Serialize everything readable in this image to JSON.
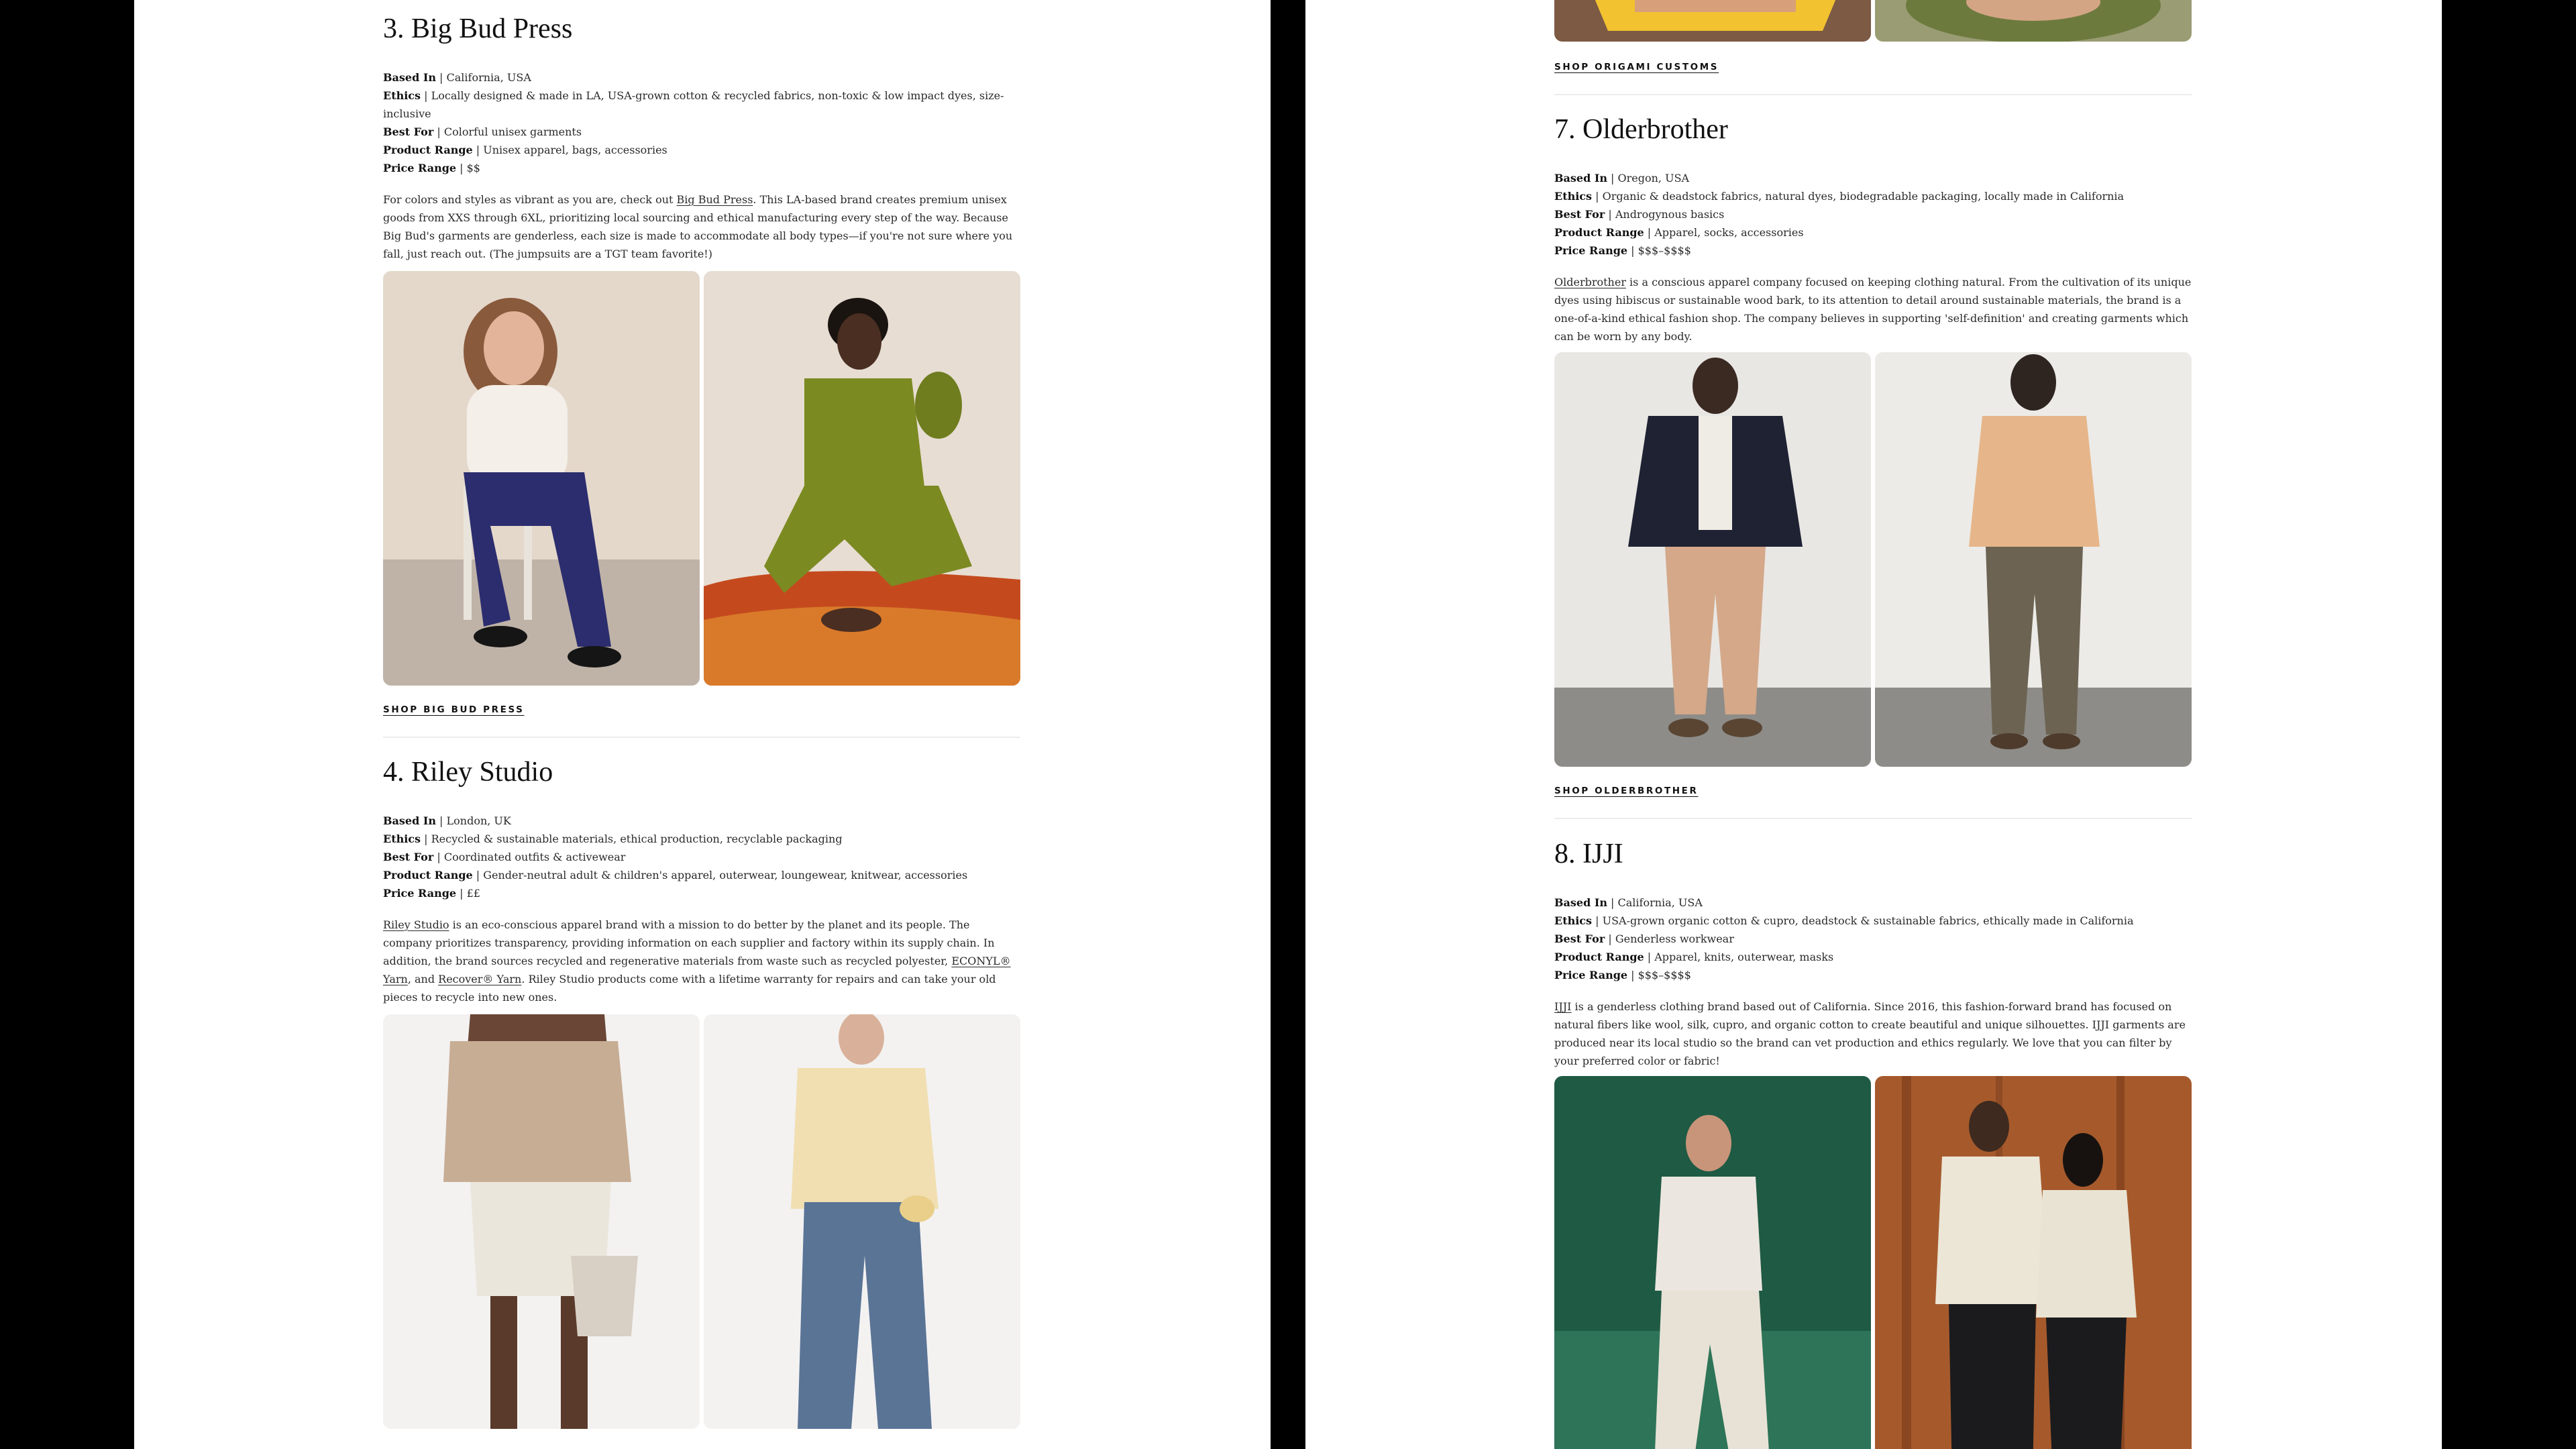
{
  "labels": {
    "based_in": "Based In",
    "ethics": "Ethics",
    "best_for": "Best For",
    "product_range": "Product Range",
    "price_range": "Price Range",
    "sep": " | "
  },
  "left": {
    "big_bud": {
      "title": "3. Big Bud Press",
      "based_in": "California, USA",
      "ethics": "Locally designed & made in LA, USA-grown cotton & recycled fabrics, non-toxic & low impact dyes, size-inclusive",
      "best_for": "Colorful unisex garments",
      "product_range": "Unisex apparel, bags, accessories",
      "price_range": "$$",
      "desc_pre": "For colors and styles as vibrant as you are, check out ",
      "desc_link": "Big Bud Press",
      "desc_post": ". This LA-based brand creates premium unisex goods from XXS through 6XL, prioritizing local sourcing and ethical manufacturing every step of the way. Because Big Bud's garments are genderless, each size is made to accommodate all body types—if you're not sure where you fall, just reach out. (The jumpsuits are a TGT team favorite!)",
      "shop": "SHOP BIG BUD PRESS"
    },
    "riley": {
      "title": "4. Riley Studio",
      "based_in": "London, UK",
      "ethics": "Recycled & sustainable materials, ethical production, recyclable packaging",
      "best_for": "Coordinated outfits & activewear",
      "product_range": "Gender-neutral adult & children's apparel, outerwear, loungewear, knitwear, accessories",
      "price_range": "££",
      "desc_link1": "Riley Studio",
      "desc_1": " is an eco-conscious apparel brand with a mission to do better by the planet and its people. The company prioritizes transparency, providing information on each supplier and factory within its supply chain. In addition, the brand sources recycled and regenerative materials from waste such as recycled polyester, ",
      "desc_link2": "ECONYL® Yarn",
      "desc_2": ", and ",
      "desc_link3": "Recover® Yarn",
      "desc_3": ". Riley Studio products come with a lifetime warranty for repairs and can take your old pieces to recycle into new ones."
    }
  },
  "right": {
    "origami": {
      "shop": "SHOP ORIGAMI CUSTOMS"
    },
    "olderbrother": {
      "title": "7. Olderbrother",
      "based_in": "Oregon, USA",
      "ethics": "Organic & deadstock fabrics, natural dyes, biodegradable packaging, locally made in California",
      "best_for": "Androgynous basics",
      "product_range": "Apparel, socks, accessories",
      "price_range": "$$$–$$$$",
      "desc_link": "Olderbrother",
      "desc_post": " is a conscious apparel company focused on keeping clothing natural. From the cultivation of its unique dyes using hibiscus or sustainable wood bark, to its attention to detail around sustainable materials, the brand is a one-of-a-kind ethical fashion shop. The company believes in supporting 'self-definition' and creating garments which can be worn by any body.",
      "shop": "SHOP OLDERBROTHER"
    },
    "ijji": {
      "title": "8. IJJI",
      "based_in": "California, USA",
      "ethics": "USA-grown organic cotton & cupro, deadstock & sustainable fabrics, ethically made in California",
      "best_for": "Genderless workwear",
      "product_range": "Apparel, knits, outerwear, masks",
      "price_range": "$$$–$$$$",
      "desc_link": "IJJI",
      "desc_post": " is a genderless clothing brand based out of California. Since 2016, this fashion-forward brand has focused on natural fibers like wool, silk, cupro, and organic cotton to create beautiful and unique silhouettes. IJJI garments are produced near its local studio so the brand can vet production and ethics regularly. We love that you can filter by your preferred color or fabric!"
    }
  },
  "colors": {
    "background": "#000000",
    "page": "#ffffff",
    "text": "#1d1d1d",
    "divider": "#ececec"
  }
}
